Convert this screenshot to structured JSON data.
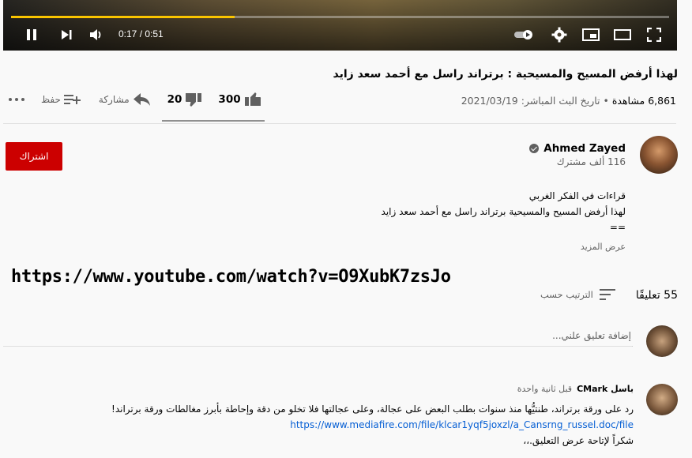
{
  "player": {
    "time_display": "0:17 / 0:51",
    "progress_fraction": 0.34,
    "buffered_color": "#f9c400",
    "icons": [
      "pause-icon",
      "next-icon",
      "volume-icon",
      "autoplay-toggle-icon",
      "settings-gear-icon",
      "miniplayer-icon",
      "theater-mode-icon",
      "fullscreen-icon"
    ]
  },
  "video": {
    "title": "لهذا أرفض المسيح والمسيحية : برتراند راسل مع أحمد سعد زايد",
    "views": "6,861 مشاهدة",
    "date": "• تاريخ البث المباشر: 2021/03/19"
  },
  "actions": {
    "likes": "300",
    "dislikes": "20",
    "share_label": "مشاركة",
    "save_label": "حفظ"
  },
  "channel": {
    "name": "Ahmed Zayed",
    "subscribers": "116 ألف مشترك",
    "subscribe_label": "اشتراك",
    "brand_color": "#cc0000"
  },
  "description": {
    "line1": "قراءات في الفكر الغربي",
    "line2": "لهذا أرفض المسيح والمسيحية برتراند راسل مع أحمد سعد زايد",
    "line3": "==",
    "show_more": "عرض المزيد"
  },
  "overlay_url": "https://www.youtube.com/watch?v=O9XubK7zsJo",
  "comments": {
    "count": "55 تعليقًا",
    "sort_label": "الترتيب حسب",
    "add_placeholder": "إضافة تعليق علني...",
    "items": [
      {
        "author": "باسل CMark",
        "time": "قبل ثانية واحدة",
        "line1": "رد على ورقة برتراند، طنتيُّها منذ سنوات بطلب البعض على عجالة، وعلى عجالتها فلا تخلو من دقة وإحاطة بأبرز مغالطات ورقة برتراند!",
        "link": "https://www.mediafire.com/file/klcar1yqf5joxzl/a_Cansrng_russel.doc/file",
        "line3": "شكراً لإتاحة عرض التعليق.،،"
      }
    ]
  }
}
